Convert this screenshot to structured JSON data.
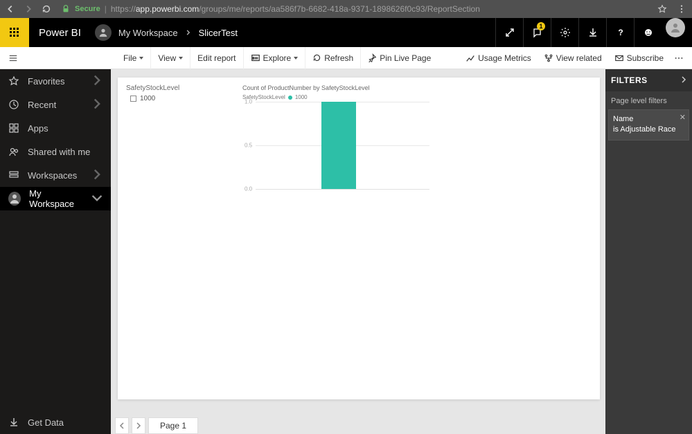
{
  "browser": {
    "secure_label": "Secure",
    "url_prefix": "https://",
    "url_host": "app.powerbi.com",
    "url_path": "/groups/me/reports/aa586f7b-6682-418a-9371-1898626f0c93/ReportSection"
  },
  "header": {
    "brand": "Power BI",
    "breadcrumb_workspace": "My Workspace",
    "breadcrumb_report": "SlicerTest",
    "notification_count": "1"
  },
  "ribbon": {
    "file": "File",
    "view": "View",
    "edit_report": "Edit report",
    "explore": "Explore",
    "refresh": "Refresh",
    "pin_live": "Pin Live Page",
    "usage_metrics": "Usage Metrics",
    "view_related": "View related",
    "subscribe": "Subscribe"
  },
  "sidebar": {
    "favorites": "Favorites",
    "recent": "Recent",
    "apps": "Apps",
    "shared": "Shared with me",
    "workspaces": "Workspaces",
    "my_workspace": "My Workspace",
    "get_data": "Get Data"
  },
  "slicer": {
    "title": "SafetyStockLevel",
    "option": "1000"
  },
  "chart_data": {
    "type": "bar",
    "title": "Count of ProductNumber by SafetyStockLevel",
    "legend_label": "SafetyStockLevel",
    "series_name": "1000",
    "categories": [
      "1000"
    ],
    "values": [
      1
    ],
    "ylim": [
      0,
      1
    ],
    "yticks": [
      0.0,
      0.5,
      1.0
    ],
    "ytick_labels": [
      "0.0",
      "0.5",
      "1.0"
    ],
    "bar_color": "#2dbfa7"
  },
  "page_tabs": {
    "page1": "Page 1"
  },
  "filters": {
    "title": "FILTERS",
    "section": "Page level filters",
    "card_field": "Name",
    "card_value": "is Adjustable Race"
  }
}
